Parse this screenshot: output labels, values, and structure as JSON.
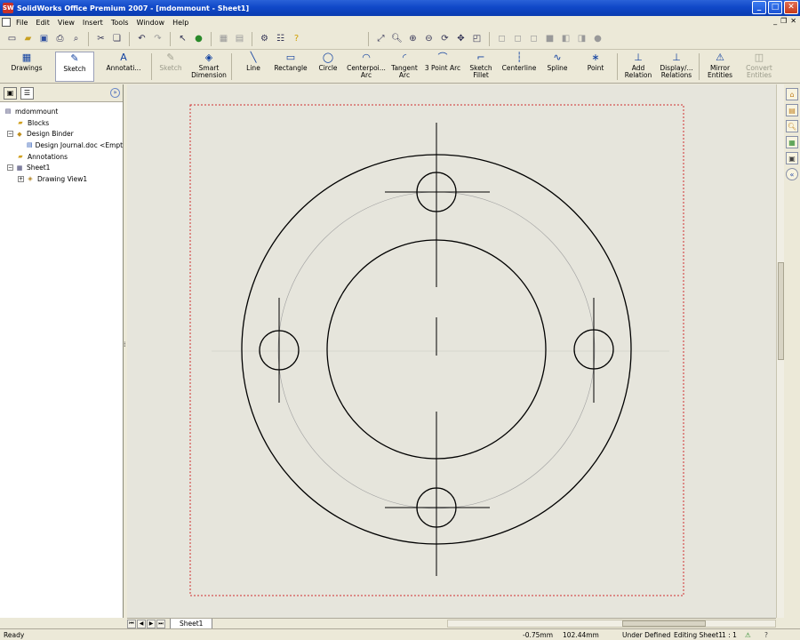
{
  "window": {
    "title": "SolidWorks Office Premium 2007 - [mdommount - Sheet1]",
    "logo": "SW"
  },
  "menu": {
    "items": [
      "File",
      "Edit",
      "View",
      "Insert",
      "Tools",
      "Window",
      "Help"
    ]
  },
  "standard_toolbar": {
    "icons": [
      "new-icon",
      "open-icon",
      "save-icon",
      "print-icon",
      "print-preview-icon",
      "undo-icon",
      "redo-icon",
      "select-icon",
      "rebuild-icon",
      "options-icon",
      "help-icon"
    ]
  },
  "command_manager": {
    "drawings": "Drawings",
    "sketch": "Sketch",
    "annotation": "Annotati...",
    "sketch_cmd": "Sketch",
    "smart_dimension": "Smart Dimension",
    "line": "Line",
    "rectangle": "Rectangle",
    "circle": "Circle",
    "centerpoint_arc": "Centerpoi... Arc",
    "tangent_arc": "Tangent Arc",
    "three_point_arc": "3 Point Arc",
    "sketch_fillet": "Sketch Fillet",
    "centerline": "Centerline",
    "spline": "Spline",
    "point": "Point",
    "add_relation": "Add Relation",
    "display_relations": "Display/... Relations",
    "mirror_entities": "Mirror Entities",
    "convert_entities": "Convert Entities"
  },
  "tree": {
    "root": "mdommount",
    "blocks": "Blocks",
    "design_binder": "Design Binder",
    "design_journal": "Design Journal.doc <Empty>",
    "annotations": "Annotations",
    "sheet": "Sheet1",
    "drawing_view": "Drawing View1"
  },
  "sheet_tabs": {
    "active": "Sheet1"
  },
  "status": {
    "left": "Ready",
    "x_coord": "-0.75mm",
    "y_coord": "102.44mm",
    "definition": "Under Defined",
    "editing": "Editing Sheet1",
    "scale": "1 : 1"
  },
  "colors": {
    "titlebar": "#1048c8",
    "canvas": "#e6e5dc",
    "sheet_border": "#d03030",
    "geometry": "#000000",
    "construction": "#a0a0a0"
  }
}
